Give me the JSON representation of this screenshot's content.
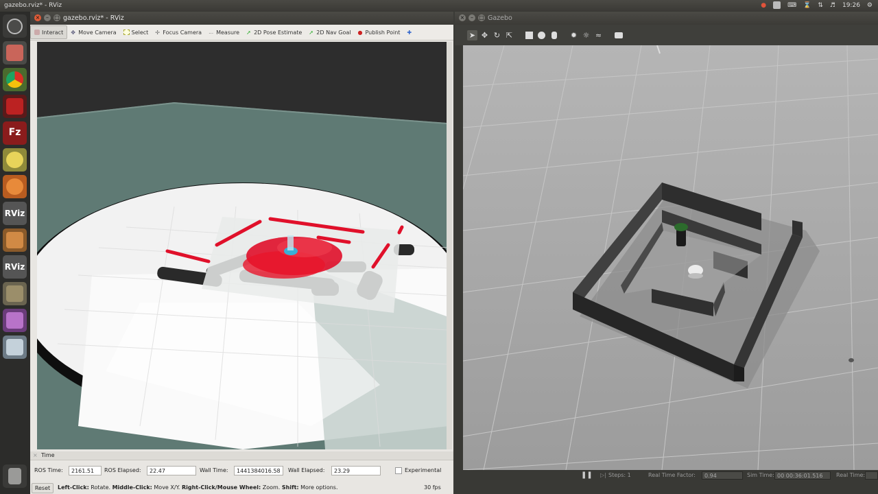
{
  "desktop": {
    "top_title": "gazebo.rviz* - RViz",
    "clock": "19:26"
  },
  "launcher": {
    "items": [
      {
        "name": "dash-home"
      },
      {
        "name": "files"
      },
      {
        "name": "chrome"
      },
      {
        "name": "terminal"
      },
      {
        "name": "filezilla"
      },
      {
        "name": "pidgin"
      },
      {
        "name": "ubuntu-software"
      },
      {
        "name": "rviz",
        "label": "RViz"
      },
      {
        "name": "package"
      },
      {
        "name": "rviz-2",
        "label": "RViz"
      },
      {
        "name": "gimp"
      },
      {
        "name": "media"
      },
      {
        "name": "system"
      },
      {
        "name": "trash"
      }
    ]
  },
  "rviz": {
    "title": "gazebo.rviz* - RViz",
    "tools": [
      {
        "label": "Interact",
        "icon": "hand-icon",
        "active": true
      },
      {
        "label": "Move Camera",
        "icon": "move-camera-icon"
      },
      {
        "label": "Select",
        "icon": "select-icon"
      },
      {
        "label": "Focus Camera",
        "icon": "focus-icon"
      },
      {
        "label": "Measure",
        "icon": "ruler-icon"
      },
      {
        "label": "2D Pose Estimate",
        "icon": "green-arrow-icon"
      },
      {
        "label": "2D Nav Goal",
        "icon": "green-arrow-icon"
      },
      {
        "label": "Publish Point",
        "icon": "pin-icon"
      }
    ],
    "time": {
      "header": "Time",
      "ros_time_label": "ROS Time:",
      "ros_time": "2161.51",
      "ros_elapsed_label": "ROS Elapsed:",
      "ros_elapsed": "22.47",
      "wall_time_label": "Wall Time:",
      "wall_time": "1441384016.58",
      "wall_elapsed_label": "Wall Elapsed:",
      "wall_elapsed": "23.29",
      "experimental_label": "Experimental"
    },
    "status": {
      "reset_label": "Reset",
      "hint_left_bold": "Left-Click:",
      "hint_left": " Rotate. ",
      "hint_mid_bold": "Middle-Click:",
      "hint_mid": " Move X/Y. ",
      "hint_right_bold": "Right-Click/Mouse Wheel:",
      "hint_right": " Zoom. ",
      "hint_shift_bold": "Shift:",
      "hint_shift": " More options.",
      "fps": "30 fps"
    }
  },
  "gazebo": {
    "title": "Gazebo",
    "bottom": {
      "steps_label": "Steps: 1",
      "rtf_label": "Real Time Factor:",
      "rtf": "0.94",
      "sim_time_label": "Sim Time:",
      "sim_time": "00 00:36:01.516",
      "real_time_label": "Real Time:"
    }
  },
  "colors": {
    "laser": "#e0102a",
    "map_floor": "#5f7a74",
    "ubuntu_panel": "#3c3b37"
  }
}
